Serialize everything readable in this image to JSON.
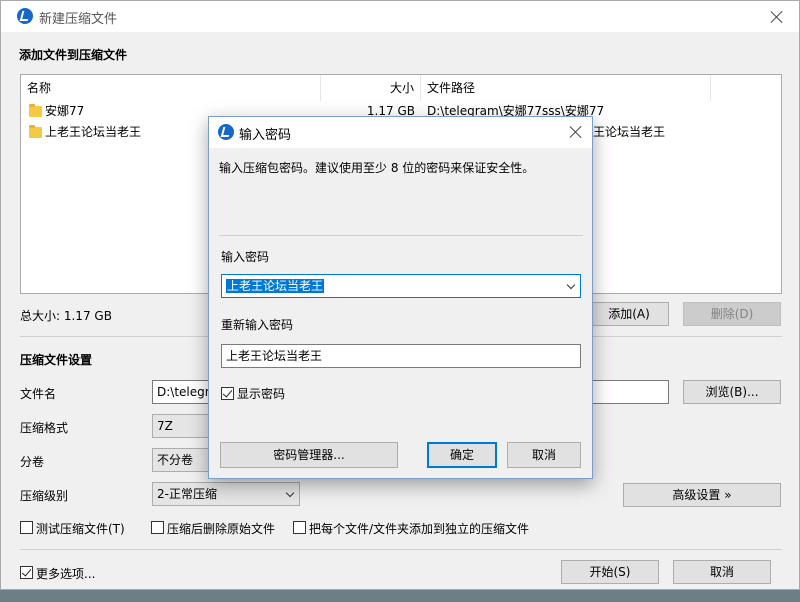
{
  "main": {
    "title": "新建压缩文件",
    "add_section_title": "添加文件到压缩文件",
    "columns": {
      "name": "名称",
      "size": "大小",
      "path": "文件路径"
    },
    "rows": [
      {
        "name": "安娜77",
        "size": "1.17 GB",
        "path": "D:\\telegram\\安娜77sss\\安娜77"
      },
      {
        "name": "上老王论坛当老王",
        "size": "",
        "path": "王论坛当老王"
      }
    ],
    "total_size": "总大小: 1.17 GB",
    "add_button": "添加(A)",
    "delete_button": "删除(D)",
    "settings_title": "压缩文件设置",
    "filename_label": "文件名",
    "filename_value": "D:\\telegra",
    "browse_button": "浏览(B)...",
    "format_label": "压缩格式",
    "format_value": "7Z",
    "split_label": "分卷",
    "split_value": "不分卷",
    "level_label": "压缩级别",
    "level_value": "2-正常压缩",
    "advanced_button": "高级设置 »",
    "test_checkbox": "测试压缩文件(T)",
    "delete_source_checkbox": "压缩后删除原始文件",
    "separate_checkbox": "把每个文件/文件夹添加到独立的压缩文件",
    "more_options_checkbox": "更多选项...",
    "start_button": "开始(S)",
    "cancel_button": "取消"
  },
  "dialog": {
    "title": "输入密码",
    "description": "输入压缩包密码。建议使用至少 8 位的密码来保证安全性。",
    "password_label": "输入密码",
    "password_value": "上老王论坛当老王",
    "confirm_label": "重新输入密码",
    "confirm_value": "上老王论坛当老王",
    "show_password": "显示密码",
    "manager_button": "密码管理器...",
    "ok_button": "确定",
    "cancel_button": "取消"
  },
  "colors": {
    "accent": "#0078d7",
    "app_icon": "#1568c8",
    "folder": "#f6c944"
  }
}
